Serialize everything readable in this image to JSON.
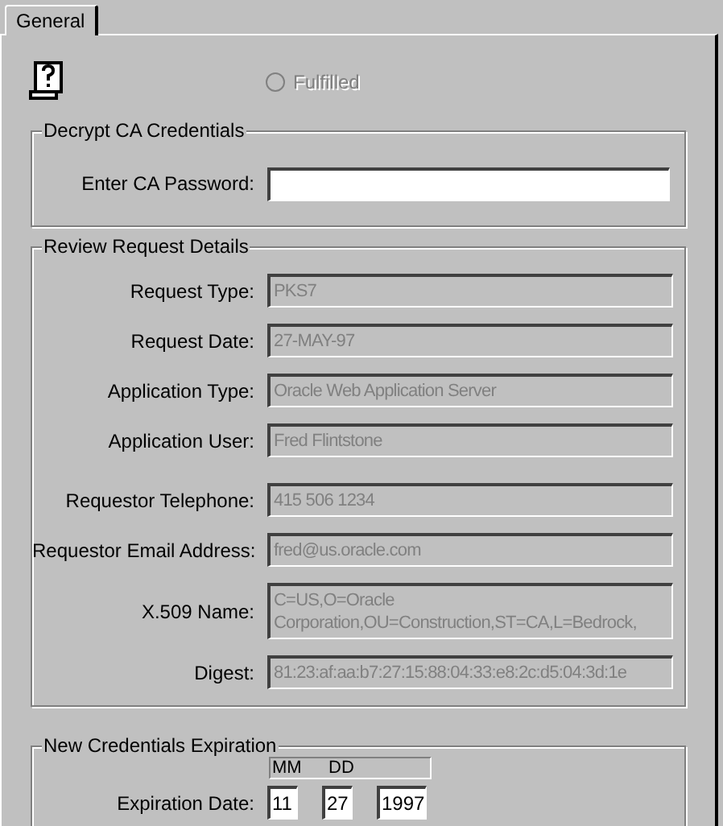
{
  "tabs": [
    {
      "label": "General",
      "selected": true
    }
  ],
  "status": {
    "label": "Fulfilled",
    "checked": false,
    "disabled": true
  },
  "decrypt": {
    "title": "Decrypt CA Credentials",
    "label": "Enter CA Password:"
  },
  "review": {
    "title": "Review Request Details",
    "fields": [
      {
        "label": "Request Type:",
        "value": "PKS7"
      },
      {
        "label": "Request Date:",
        "value": "27-MAY-97"
      },
      {
        "label": "Application Type:",
        "value": "Oracle Web Application Server"
      },
      {
        "label": "Application User:",
        "value": "Fred Flintstone"
      },
      {
        "label": "Requestor Telephone:",
        "value": "415 506 1234"
      },
      {
        "label": "Requestor Email Address:",
        "value": "fred@us.oracle.com"
      },
      {
        "label": "X.509 Name:",
        "value": "C=US,O=Oracle Corporation,OU=Construction,ST=CA,L=Bedrock,"
      },
      {
        "label": "Digest:",
        "value": "81:23:af:aa:b7:27:15:88:04:33:e8:2c:d5:04:3d:1e"
      }
    ]
  },
  "expiration": {
    "title": "New Credentials Expiration",
    "label": "Expiration Date:",
    "headers": [
      "MM",
      "DD"
    ],
    "month": "11",
    "day": "27",
    "year": "1997"
  }
}
